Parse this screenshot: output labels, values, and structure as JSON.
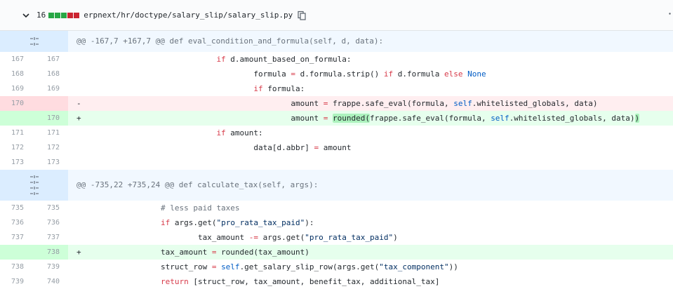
{
  "file": {
    "changes": "16",
    "path": "erpnext/hr/doctype/salary_slip/salary_slip.py"
  },
  "hunks": [
    {
      "header": "@@ -167,7 +167,7 @@ def eval_condition_and_formula(self, d, data):"
    },
    {
      "header": "@@ -735,22 +735,24 @@ def calculate_tax(self, args):"
    }
  ],
  "lines": {
    "l167": {
      "old": "167",
      "new": "167",
      "code": "                            if d.amount_based_on_formula:"
    },
    "l168": {
      "old": "168",
      "new": "168",
      "code": "                                    formula = d.formula.strip() if d.formula else None"
    },
    "l169": {
      "old": "169",
      "new": "169",
      "code": "                                    if formula:"
    },
    "l170d": {
      "old": "170",
      "new": "",
      "marker": "-",
      "code": "                                            amount = frappe.safe_eval(formula, self.whitelisted_globals, data)"
    },
    "l170a": {
      "old": "",
      "new": "170",
      "marker": "+",
      "code": "                                            amount = rounded(frappe.safe_eval(formula, self.whitelisted_globals, data))"
    },
    "l171": {
      "old": "171",
      "new": "171",
      "code": "                            if amount:"
    },
    "l172": {
      "old": "172",
      "new": "172",
      "code": "                                    data[d.abbr] = amount"
    },
    "l173": {
      "old": "173",
      "new": "173",
      "code": ""
    },
    "l735": {
      "old": "735",
      "new": "735",
      "code": "                # less paid taxes"
    },
    "l736": {
      "old": "736",
      "new": "736",
      "code": "                if args.get(\"pro_rata_tax_paid\"):"
    },
    "l737": {
      "old": "737",
      "new": "737",
      "code": "                        tax_amount -= args.get(\"pro_rata_tax_paid\")"
    },
    "l738a": {
      "old": "",
      "new": "738",
      "marker": "+",
      "code": "                tax_amount = rounded(tax_amount)"
    },
    "l738": {
      "old": "738",
      "new": "739",
      "code": "                struct_row = self.get_salary_slip_row(args.get(\"tax_component\"))"
    },
    "l739": {
      "old": "739",
      "new": "740",
      "code": "                return [struct_row, tax_amount, benefit_tax, additional_tax]"
    }
  },
  "colors": {
    "deletion_bg": "#ffeef0",
    "addition_bg": "#e6ffed",
    "hunk_bg": "#f1f8ff",
    "keyword": "#d73a49",
    "builtin": "#005cc5"
  },
  "icons": [
    "chevron-down-icon",
    "copy-icon",
    "expand-icon",
    "kebab-icon"
  ]
}
